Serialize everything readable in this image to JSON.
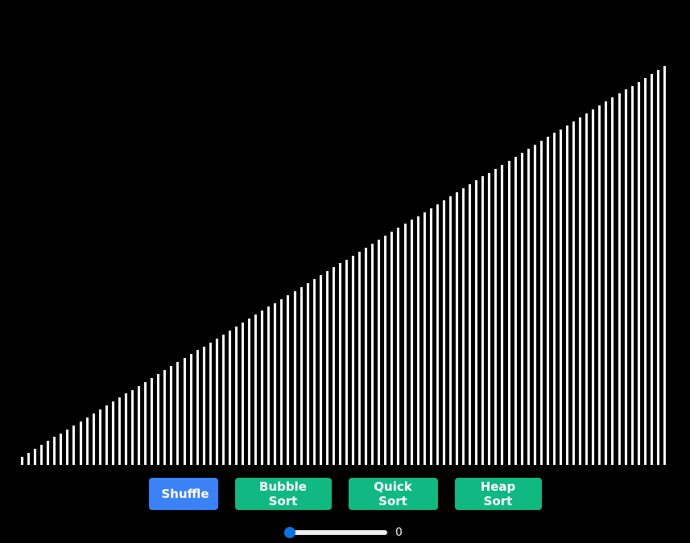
{
  "colors": {
    "background": "#000000",
    "bar": "#ffffff",
    "shuffle_button": "#3b82f6",
    "sort_button": "#10b981",
    "slider_accent": "#0a74e5"
  },
  "array": {
    "count": 100,
    "values": [
      1,
      2,
      3,
      4,
      5,
      6,
      7,
      8,
      9,
      10,
      11,
      12,
      13,
      14,
      15,
      16,
      17,
      18,
      19,
      20,
      21,
      22,
      23,
      24,
      25,
      26,
      27,
      28,
      29,
      30,
      31,
      32,
      33,
      34,
      35,
      36,
      37,
      38,
      39,
      40,
      41,
      42,
      43,
      44,
      45,
      46,
      47,
      48,
      49,
      50,
      51,
      52,
      53,
      54,
      55,
      56,
      57,
      58,
      59,
      60,
      61,
      62,
      63,
      64,
      65,
      66,
      67,
      68,
      69,
      70,
      71,
      72,
      73,
      74,
      75,
      76,
      77,
      78,
      79,
      80,
      81,
      82,
      83,
      84,
      85,
      86,
      87,
      88,
      89,
      90,
      91,
      92,
      93,
      94,
      95,
      96,
      97,
      98,
      99,
      100
    ],
    "max": 100
  },
  "controls": {
    "shuffle_label": "Shuffle",
    "bubble_sort_label": "Bubble Sort",
    "quick_sort_label": "Quick Sort",
    "heap_sort_label": "Heap Sort"
  },
  "speed": {
    "value": "0",
    "level": 0
  }
}
